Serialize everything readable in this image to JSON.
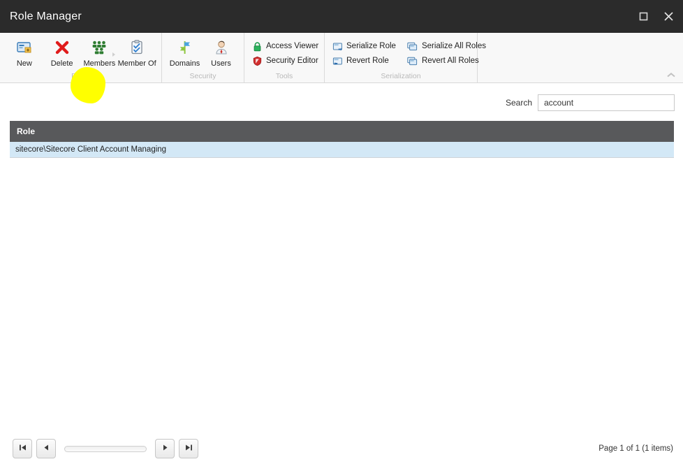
{
  "window": {
    "title": "Role Manager",
    "buttons": [
      {
        "name": "maximize",
        "icon": "maximize-icon"
      },
      {
        "name": "close",
        "icon": "close-icon"
      }
    ]
  },
  "ribbon": {
    "collapse_icon": "chevron-up-icon",
    "groups": [
      {
        "label": "Roles",
        "type": "large",
        "items": [
          {
            "label": "New",
            "icon": "new-role-icon"
          },
          {
            "label": "Delete",
            "icon": "delete-icon"
          },
          {
            "label": "Members",
            "icon": "members-icon",
            "highlighted": true,
            "has_caret": true
          },
          {
            "label": "Member Of",
            "icon": "member-of-icon"
          }
        ]
      },
      {
        "label": "Security",
        "type": "large",
        "items": [
          {
            "label": "Domains",
            "icon": "domains-icon"
          },
          {
            "label": "Users",
            "icon": "users-icon"
          }
        ]
      },
      {
        "label": "Tools",
        "type": "small",
        "columns": [
          [
            {
              "label": "Access Viewer",
              "icon": "lock-icon"
            },
            {
              "label": "Security Editor",
              "icon": "shield-icon"
            }
          ]
        ]
      },
      {
        "label": "Serialization",
        "type": "small",
        "columns": [
          [
            {
              "label": "Serialize Role",
              "icon": "serialize-icon"
            },
            {
              "label": "Revert Role",
              "icon": "revert-icon"
            }
          ],
          [
            {
              "label": "Serialize All Roles",
              "icon": "serialize-all-icon"
            },
            {
              "label": "Revert All Roles",
              "icon": "revert-all-icon"
            }
          ]
        ]
      }
    ]
  },
  "search": {
    "label": "Search",
    "value": "account",
    "placeholder": ""
  },
  "grid": {
    "columns": [
      "Role"
    ],
    "rows": [
      {
        "role": "sitecore\\Sitecore Client Account Managing",
        "selected": true
      }
    ]
  },
  "pager": {
    "first_label": "first-page",
    "prev_label": "previous-page",
    "next_label": "next-page",
    "last_label": "last-page",
    "status": "Page 1 of 1 (1 items)"
  },
  "colors": {
    "titlebar_bg": "#2b2b2b",
    "ribbon_bg": "#f8f8f8",
    "grid_header_bg": "#58595b",
    "row_selected_bg": "#d3e8f6",
    "highlighter": "#ffff00"
  }
}
